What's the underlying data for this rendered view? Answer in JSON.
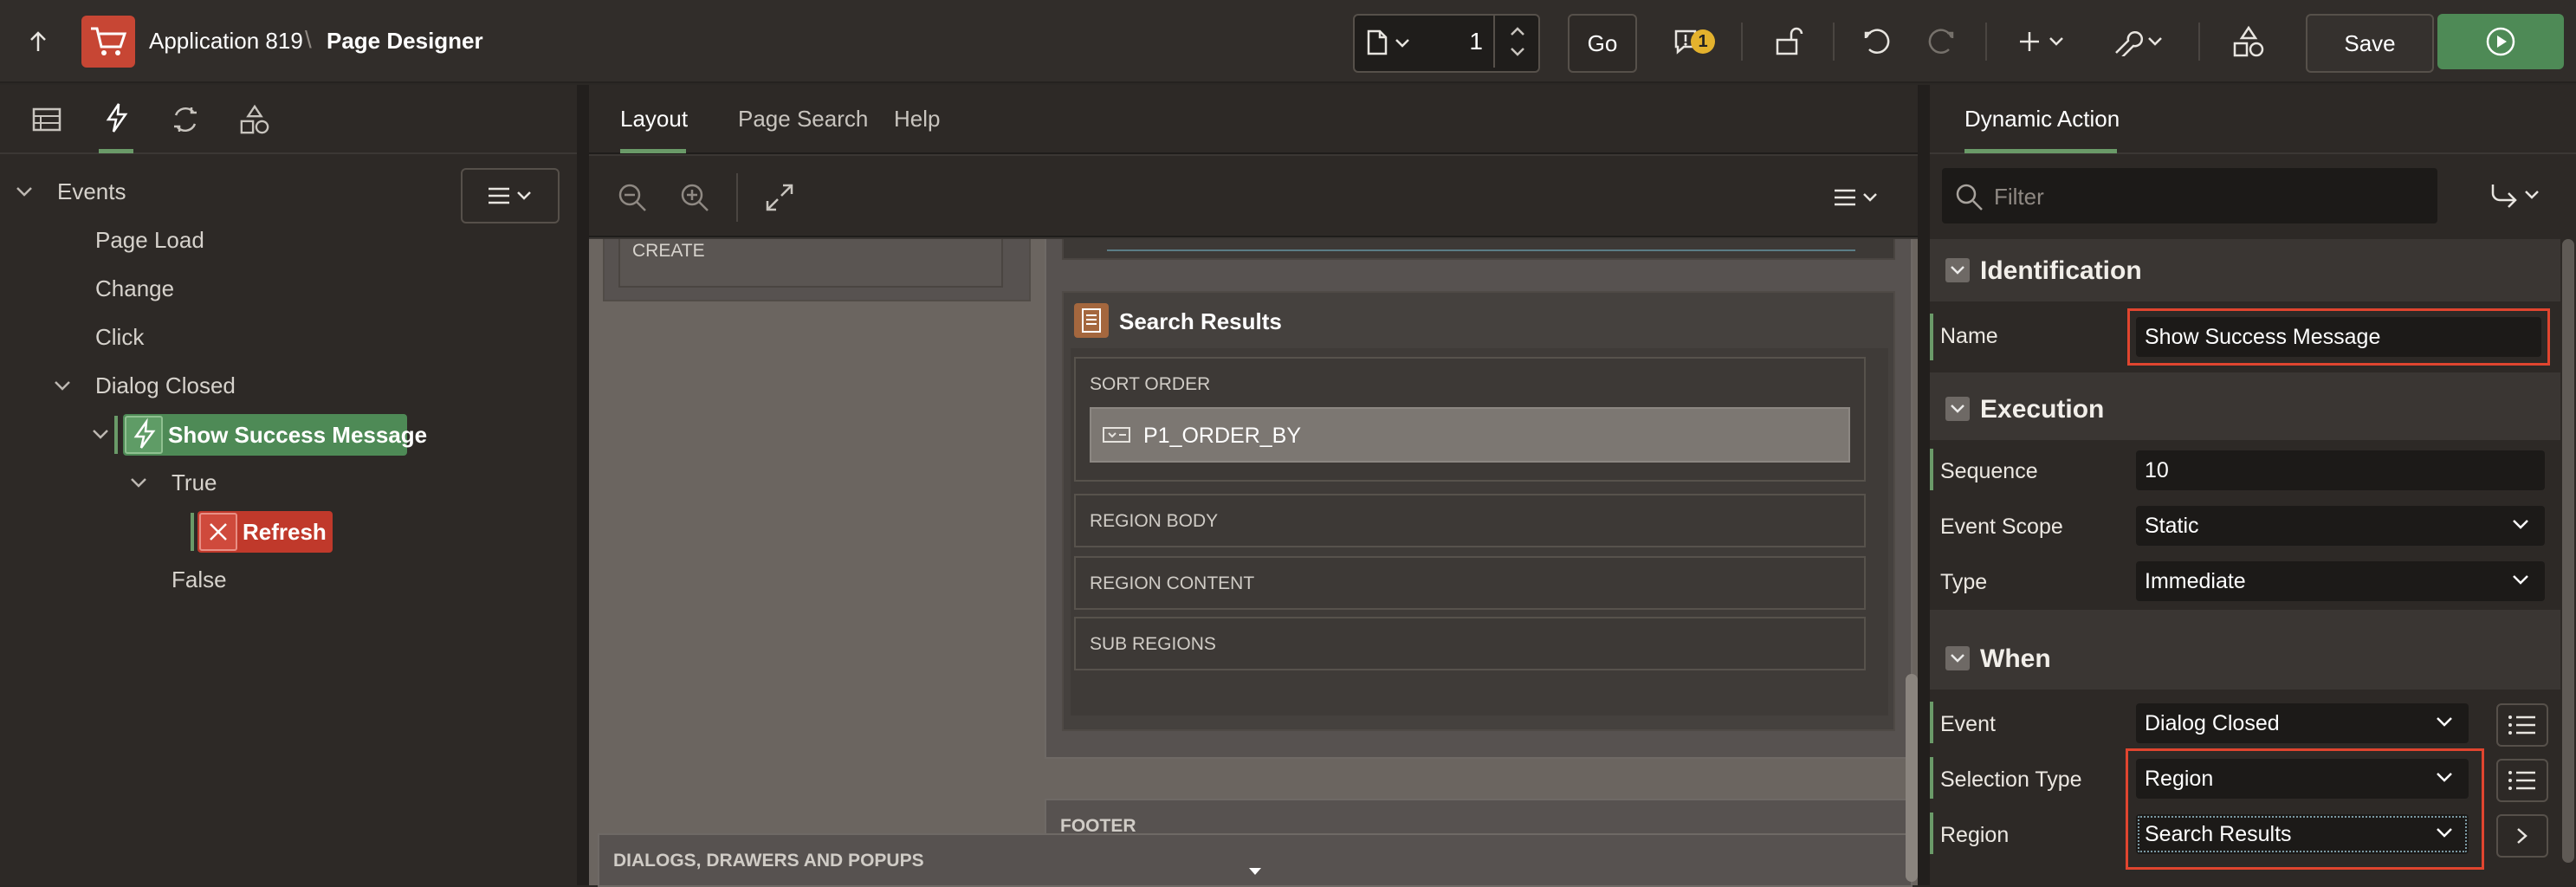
{
  "header": {
    "app_name": "Application 819",
    "separator": "\\",
    "page_title": "Page Designer",
    "page_number": "1",
    "go_label": "Go",
    "warning_count": "1",
    "save_label": "Save"
  },
  "left": {
    "events_label": "Events",
    "items": [
      "Page Load",
      "Change",
      "Click",
      "Dialog Closed"
    ],
    "dynamic_action": "Show Success Message",
    "true_label": "True",
    "action_label": "Refresh",
    "false_label": "False"
  },
  "center": {
    "tabs": [
      "Layout",
      "Page Search",
      "Help"
    ],
    "create_label": "CREATE",
    "region_title": "Search Results",
    "sort_order_label": "SORT ORDER",
    "item_name": "P1_ORDER_BY",
    "region_body": "REGION BODY",
    "region_content": "REGION CONTENT",
    "sub_regions": "SUB REGIONS",
    "footer": "FOOTER",
    "dialogs": "DIALOGS, DRAWERS AND POPUPS"
  },
  "right": {
    "tab_label": "Dynamic Action",
    "filter_placeholder": "Filter",
    "identification": "Identification",
    "name_label": "Name",
    "name_value": "Show Success Message",
    "execution": "Execution",
    "sequence_label": "Sequence",
    "sequence_value": "10",
    "scope_label": "Event Scope",
    "scope_value": "Static",
    "type_label": "Type",
    "type_value": "Immediate",
    "when": "When",
    "event_label": "Event",
    "event_value": "Dialog Closed",
    "selection_type_label": "Selection Type",
    "selection_type_value": "Region",
    "region_label": "Region",
    "region_value": "Search Results"
  },
  "colors": {
    "accent_green": "#4e8a56",
    "highlight_red": "#e0452f",
    "refresh_red": "#c0392b",
    "logo_red": "#c74634"
  },
  "icons": [
    "up-arrow-icon",
    "cart-icon",
    "page-icon",
    "warning-icon",
    "unlock-icon",
    "undo-icon",
    "redo-icon",
    "plus-icon",
    "wrench-icon",
    "shapes-icon",
    "run-icon",
    "lightning-icon",
    "close-icon",
    "filter-icon",
    "menu-icon",
    "zoom-out-icon",
    "zoom-in-icon",
    "expand-icon"
  ]
}
